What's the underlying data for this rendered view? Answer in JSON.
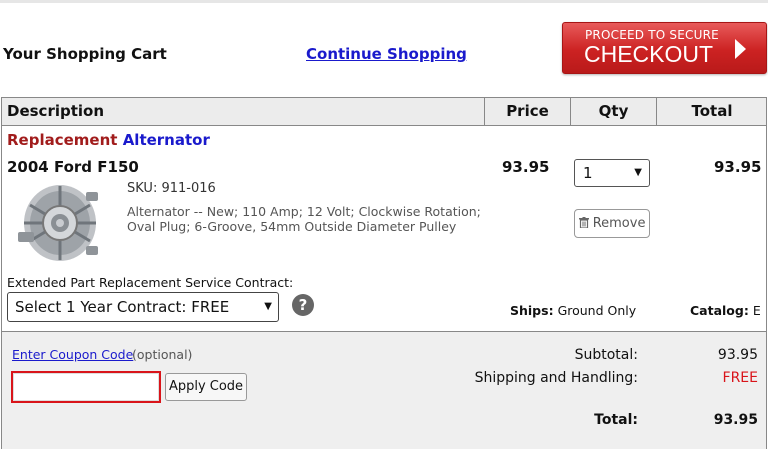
{
  "page": {
    "cart_title": "Your Shopping Cart",
    "continue_shopping": "Continue Shopping",
    "checkout_small": "PROCEED TO SECURE",
    "checkout_big": "CHECKOUT"
  },
  "table": {
    "headers": [
      "Description",
      "Price",
      "Qty",
      "Total"
    ]
  },
  "item": {
    "category_a": "Replacement",
    "category_b": "Alternator",
    "vehicle": "2004 Ford F150",
    "sku": "SKU: 911-016",
    "description": "Alternator -- New; 110 Amp; 12 Volt; Clockwise Rotation; Oval Plug; 6-Groove, 54mm Outside Diameter Pulley",
    "price": "93.95",
    "qty": "1",
    "remove": "Remove",
    "total": "93.95",
    "contract_label": "Extended Part Replacement Service Contract:",
    "contract_selected": "Select 1 Year Contract: FREE",
    "help": "?",
    "ships_label": "Ships:",
    "ships_value": "Ground Only",
    "catalog_label": "Catalog:",
    "catalog_value": "E"
  },
  "summary": {
    "coupon_link": "Enter Coupon Code",
    "coupon_optional": "(optional)",
    "coupon_value": "",
    "apply": "Apply Code",
    "subtotal_label": "Subtotal:",
    "subtotal_value": "93.95",
    "shipping_label": "Shipping and Handling:",
    "shipping_value": "FREE",
    "total_label": "Total:",
    "total_value": "93.95"
  },
  "colors": {
    "checkout_red": "#cc2222",
    "link_blue": "#1a1acc",
    "category_red": "#a11c1c",
    "free_red": "#d9141a",
    "coupon_border": "#d9141a"
  },
  "icons": [
    "chevron-right-icon",
    "caret-down-icon",
    "trash-icon",
    "question-icon"
  ]
}
